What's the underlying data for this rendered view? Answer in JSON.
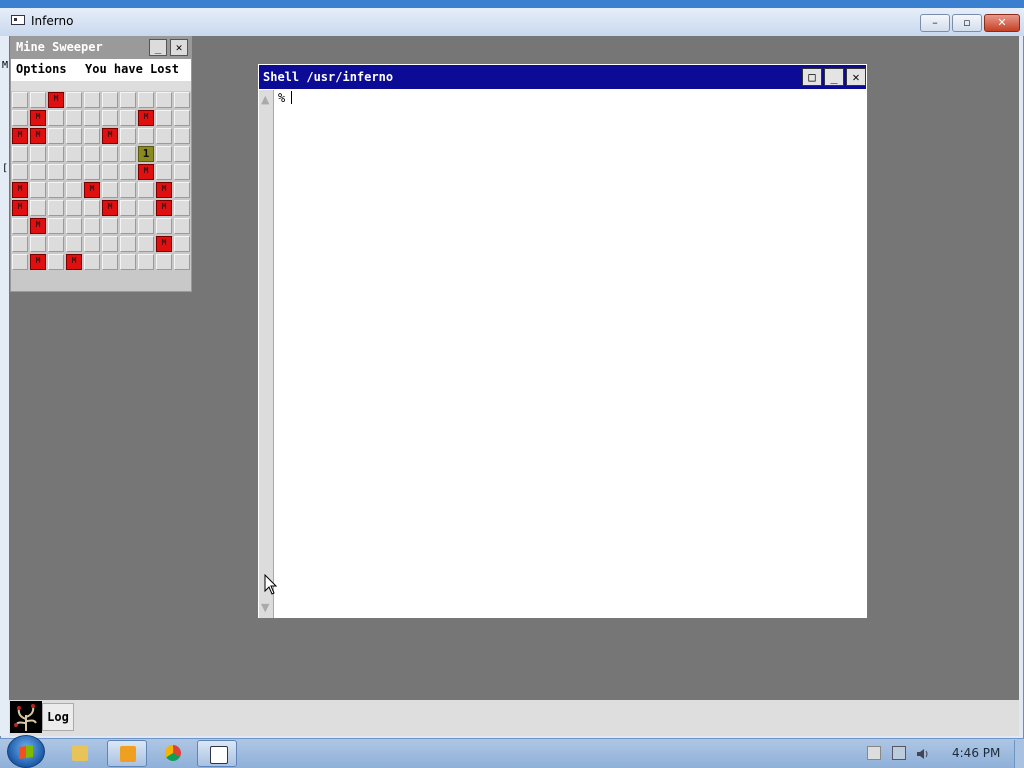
{
  "host_window": {
    "title": "Inferno",
    "minimize_glyph": "–",
    "maximize_glyph": "▫",
    "close_glyph": "✕"
  },
  "stray_glyphs": {
    "top": "M",
    "middle": "["
  },
  "minesweeper": {
    "title": "Mine Sweeper",
    "minimize_glyph": "_",
    "close_glyph": "✕",
    "menu_options": "Options",
    "status": "You have Lost",
    "rows": 10,
    "cols": 10,
    "mines": [
      [
        0,
        2
      ],
      [
        1,
        1
      ],
      [
        1,
        7
      ],
      [
        2,
        0
      ],
      [
        2,
        1
      ],
      [
        2,
        5
      ],
      [
        4,
        7
      ],
      [
        5,
        0
      ],
      [
        5,
        4
      ],
      [
        5,
        8
      ],
      [
        6,
        0
      ],
      [
        6,
        5
      ],
      [
        6,
        8
      ],
      [
        7,
        1
      ],
      [
        8,
        8
      ],
      [
        9,
        1
      ],
      [
        9,
        3
      ]
    ],
    "numbers": [
      {
        "r": 3,
        "c": 7,
        "v": "1"
      }
    ]
  },
  "shell": {
    "title": "Shell /usr/inferno",
    "btn_maximize": "□",
    "btn_minimize": "_",
    "btn_close": "✕",
    "prompt": "%"
  },
  "inferno_taskbar": {
    "log_label": "Log"
  },
  "windows_taskbar": {
    "clock": "4:46 PM",
    "pinned": [
      "explorer",
      "media-player",
      "chrome",
      "inferno"
    ]
  }
}
